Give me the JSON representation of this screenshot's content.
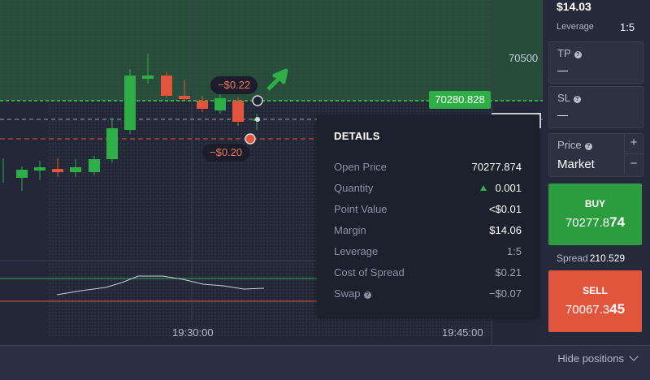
{
  "chart": {
    "price_tick": "70500",
    "current_price": "70280.828",
    "take_profit_pnl": "−$0.22",
    "stop_loss_pnl": "−$0.20",
    "time_labels": [
      "19:30:00",
      "19:45:00"
    ],
    "colors": {
      "up": "#2eae46",
      "down": "#e2553d"
    }
  },
  "details": {
    "title": "DETAILS",
    "rows": [
      {
        "label": "Open Price",
        "value": "70277.874"
      },
      {
        "label": "Quantity",
        "value": "0.001"
      },
      {
        "label": "Point Value",
        "value": "<$0.01"
      },
      {
        "label": "Margin",
        "value": "$14.06"
      },
      {
        "label": "Leverage",
        "value": "1:5"
      },
      {
        "label": "Cost of Spread",
        "value": "$0.21"
      },
      {
        "label": "Swap",
        "value": "−$0.07"
      }
    ]
  },
  "panel": {
    "balance": "$14.03",
    "leverage_label": "Leverage",
    "leverage_value": "1:5",
    "tp_label": "TP",
    "tp_value": "—",
    "sl_label": "SL",
    "sl_value": "—",
    "price_label": "Price",
    "price_value": "Market",
    "plus": "+",
    "minus": "−",
    "buy_label": "BUY",
    "buy_price_main": "70277.8",
    "buy_price_big": "74",
    "spread_label": "Spread",
    "spread_value": "210.529",
    "sell_label": "SELL",
    "sell_price_main": "70067.3",
    "sell_price_big": "45"
  },
  "bottom": {
    "hide_positions": "Hide positions"
  }
}
